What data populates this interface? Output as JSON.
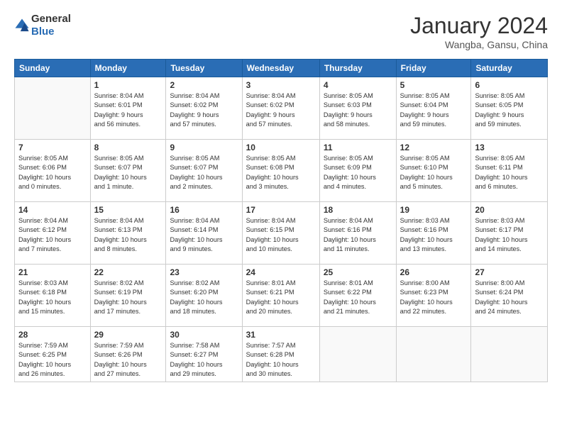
{
  "logo": {
    "text_general": "General",
    "text_blue": "Blue"
  },
  "header": {
    "month_year": "January 2024",
    "location": "Wangba, Gansu, China"
  },
  "weekdays": [
    "Sunday",
    "Monday",
    "Tuesday",
    "Wednesday",
    "Thursday",
    "Friday",
    "Saturday"
  ],
  "weeks": [
    [
      {
        "day": "",
        "info": ""
      },
      {
        "day": "1",
        "info": "Sunrise: 8:04 AM\nSunset: 6:01 PM\nDaylight: 9 hours\nand 56 minutes."
      },
      {
        "day": "2",
        "info": "Sunrise: 8:04 AM\nSunset: 6:02 PM\nDaylight: 9 hours\nand 57 minutes."
      },
      {
        "day": "3",
        "info": "Sunrise: 8:04 AM\nSunset: 6:02 PM\nDaylight: 9 hours\nand 57 minutes."
      },
      {
        "day": "4",
        "info": "Sunrise: 8:05 AM\nSunset: 6:03 PM\nDaylight: 9 hours\nand 58 minutes."
      },
      {
        "day": "5",
        "info": "Sunrise: 8:05 AM\nSunset: 6:04 PM\nDaylight: 9 hours\nand 59 minutes."
      },
      {
        "day": "6",
        "info": "Sunrise: 8:05 AM\nSunset: 6:05 PM\nDaylight: 9 hours\nand 59 minutes."
      }
    ],
    [
      {
        "day": "7",
        "info": "Sunrise: 8:05 AM\nSunset: 6:06 PM\nDaylight: 10 hours\nand 0 minutes."
      },
      {
        "day": "8",
        "info": "Sunrise: 8:05 AM\nSunset: 6:07 PM\nDaylight: 10 hours\nand 1 minute."
      },
      {
        "day": "9",
        "info": "Sunrise: 8:05 AM\nSunset: 6:07 PM\nDaylight: 10 hours\nand 2 minutes."
      },
      {
        "day": "10",
        "info": "Sunrise: 8:05 AM\nSunset: 6:08 PM\nDaylight: 10 hours\nand 3 minutes."
      },
      {
        "day": "11",
        "info": "Sunrise: 8:05 AM\nSunset: 6:09 PM\nDaylight: 10 hours\nand 4 minutes."
      },
      {
        "day": "12",
        "info": "Sunrise: 8:05 AM\nSunset: 6:10 PM\nDaylight: 10 hours\nand 5 minutes."
      },
      {
        "day": "13",
        "info": "Sunrise: 8:05 AM\nSunset: 6:11 PM\nDaylight: 10 hours\nand 6 minutes."
      }
    ],
    [
      {
        "day": "14",
        "info": "Sunrise: 8:04 AM\nSunset: 6:12 PM\nDaylight: 10 hours\nand 7 minutes."
      },
      {
        "day": "15",
        "info": "Sunrise: 8:04 AM\nSunset: 6:13 PM\nDaylight: 10 hours\nand 8 minutes."
      },
      {
        "day": "16",
        "info": "Sunrise: 8:04 AM\nSunset: 6:14 PM\nDaylight: 10 hours\nand 9 minutes."
      },
      {
        "day": "17",
        "info": "Sunrise: 8:04 AM\nSunset: 6:15 PM\nDaylight: 10 hours\nand 10 minutes."
      },
      {
        "day": "18",
        "info": "Sunrise: 8:04 AM\nSunset: 6:16 PM\nDaylight: 10 hours\nand 11 minutes."
      },
      {
        "day": "19",
        "info": "Sunrise: 8:03 AM\nSunset: 6:16 PM\nDaylight: 10 hours\nand 13 minutes."
      },
      {
        "day": "20",
        "info": "Sunrise: 8:03 AM\nSunset: 6:17 PM\nDaylight: 10 hours\nand 14 minutes."
      }
    ],
    [
      {
        "day": "21",
        "info": "Sunrise: 8:03 AM\nSunset: 6:18 PM\nDaylight: 10 hours\nand 15 minutes."
      },
      {
        "day": "22",
        "info": "Sunrise: 8:02 AM\nSunset: 6:19 PM\nDaylight: 10 hours\nand 17 minutes."
      },
      {
        "day": "23",
        "info": "Sunrise: 8:02 AM\nSunset: 6:20 PM\nDaylight: 10 hours\nand 18 minutes."
      },
      {
        "day": "24",
        "info": "Sunrise: 8:01 AM\nSunset: 6:21 PM\nDaylight: 10 hours\nand 20 minutes."
      },
      {
        "day": "25",
        "info": "Sunrise: 8:01 AM\nSunset: 6:22 PM\nDaylight: 10 hours\nand 21 minutes."
      },
      {
        "day": "26",
        "info": "Sunrise: 8:00 AM\nSunset: 6:23 PM\nDaylight: 10 hours\nand 22 minutes."
      },
      {
        "day": "27",
        "info": "Sunrise: 8:00 AM\nSunset: 6:24 PM\nDaylight: 10 hours\nand 24 minutes."
      }
    ],
    [
      {
        "day": "28",
        "info": "Sunrise: 7:59 AM\nSunset: 6:25 PM\nDaylight: 10 hours\nand 26 minutes."
      },
      {
        "day": "29",
        "info": "Sunrise: 7:59 AM\nSunset: 6:26 PM\nDaylight: 10 hours\nand 27 minutes."
      },
      {
        "day": "30",
        "info": "Sunrise: 7:58 AM\nSunset: 6:27 PM\nDaylight: 10 hours\nand 29 minutes."
      },
      {
        "day": "31",
        "info": "Sunrise: 7:57 AM\nSunset: 6:28 PM\nDaylight: 10 hours\nand 30 minutes."
      },
      {
        "day": "",
        "info": ""
      },
      {
        "day": "",
        "info": ""
      },
      {
        "day": "",
        "info": ""
      }
    ]
  ]
}
